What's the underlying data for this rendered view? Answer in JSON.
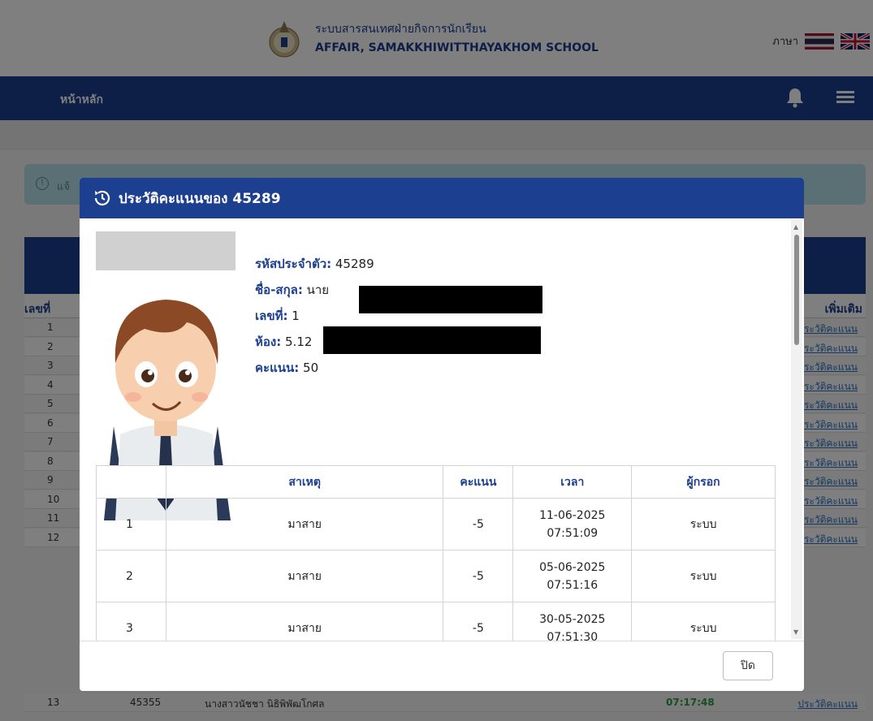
{
  "header": {
    "system_name": "ระบบสารสนเทศฝ่ายกิจการนักเรียน",
    "school_name": "AFFAIR, SAMAKKHIWITTHAYAKHOM SCHOOL",
    "lang_label": "ภาษา"
  },
  "nav": {
    "home": "หน้าหลัก"
  },
  "alert": {
    "text": "แจ้"
  },
  "bg_table": {
    "col_no": "เลขที่",
    "col_more": "เพิ่มเติม",
    "link_text": "ประวัติคะแนน",
    "rows": [
      "1",
      "2",
      "3",
      "4",
      "5",
      "6",
      "7",
      "8",
      "9",
      "10",
      "11",
      "12"
    ],
    "last_row": {
      "no": "13",
      "id": "45355",
      "name": "นางสาวนัชชา นิธิพิพัฒโกศล",
      "time": "07:17:48",
      "link": "ประวัติคะแนน"
    }
  },
  "modal": {
    "title": "ประวัติคะแนนของ 45289",
    "student": {
      "id_label": "รหัสประจำตัว:",
      "id_value": "45289",
      "name_label": "ชื่อ-สกุล:",
      "name_value": "นาย",
      "no_label": "เลขที่:",
      "no_value": "1",
      "room_label": "ห้อง:",
      "room_value": "5.12",
      "score_label": "คะแนน:",
      "score_value": "50"
    },
    "table": {
      "headers": [
        "",
        "สาเหตุ",
        "คะแนน",
        "เวลา",
        "ผู้กรอก"
      ],
      "rows": [
        {
          "no": "1",
          "reason": "มาสาย",
          "score": "-5",
          "date": "11-06-2025",
          "time": "07:51:09",
          "by": "ระบบ"
        },
        {
          "no": "2",
          "reason": "มาสาย",
          "score": "-5",
          "date": "05-06-2025",
          "time": "07:51:16",
          "by": "ระบบ"
        },
        {
          "no": "3",
          "reason": "มาสาย",
          "score": "-5",
          "date": "30-05-2025",
          "time": "07:51:30",
          "by": "ระบบ"
        }
      ]
    },
    "close_label": "ปิด"
  },
  "colors": {
    "primary": "#1c3f8f",
    "alert_bg": "#b6e0ea",
    "link": "#2a6fc4",
    "time_green": "#2e9d3a"
  }
}
